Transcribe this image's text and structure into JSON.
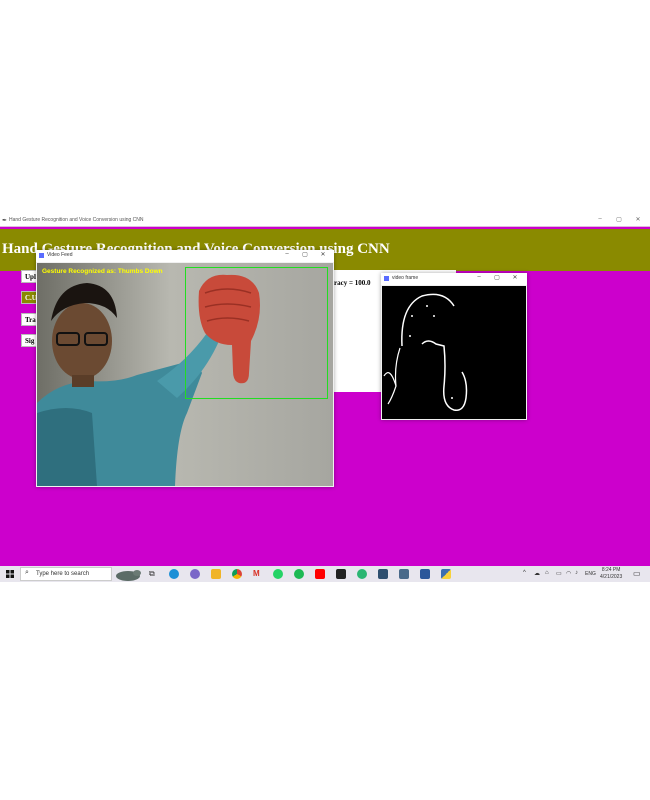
{
  "app": {
    "title": "Hand Gesture Recognition and Voice Conversion using CNN",
    "heading": "Hand Gesture Recognition and Voice Conversion using CNN",
    "buttons": [
      "Upl",
      "C.U",
      "Tra",
      "Sig"
    ],
    "accuracy_text": "curacy = 100.0",
    "colors": {
      "background": "#cc00cc",
      "header": "#8a8a00"
    }
  },
  "video_feed": {
    "title": "Video Feed",
    "gesture_text": "Gesture Recognized as: Thumbs Down",
    "roi_color": "#22dd22"
  },
  "video_frame": {
    "title": "video frame"
  },
  "taskbar": {
    "search_placeholder": "Type here to search",
    "language": "ENG",
    "time": "8:24 PM",
    "date": "4/21/2023",
    "icons": [
      "windows-icon",
      "search-icon",
      "task-view-icon",
      "edge-icon",
      "settings-icon",
      "file-explorer-icon",
      "chrome-icon",
      "gmail-icon",
      "whatsapp-icon",
      "spotify-icon",
      "youtube-icon",
      "terminal-icon",
      "browser-icon",
      "app-icon",
      "app-icon",
      "word-icon",
      "python-icon"
    ]
  }
}
